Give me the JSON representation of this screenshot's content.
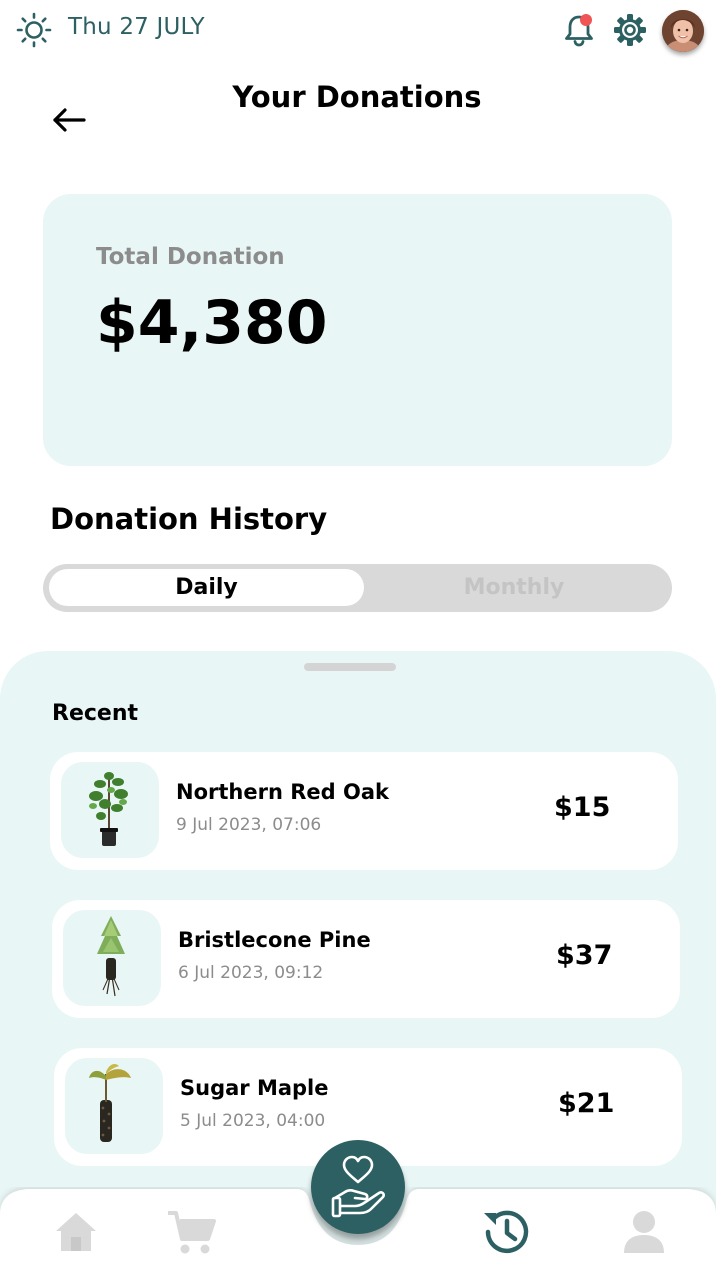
{
  "status_bar": {
    "date": "Thu 27 JULY",
    "weather_icon": "sun-icon",
    "notification_icon": "bell-icon",
    "settings_icon": "gear-icon",
    "has_unread_notification": true
  },
  "header": {
    "title": "Your Donations",
    "back_icon": "arrow-left-icon"
  },
  "summary": {
    "label": "Total Donation",
    "value": "$4,380"
  },
  "history": {
    "heading": "Donation History",
    "tabs": [
      {
        "label": "Daily",
        "selected": true
      },
      {
        "label": "Monthly",
        "selected": false
      }
    ]
  },
  "recent": {
    "heading": "Recent",
    "items": [
      {
        "name": "Northern Red Oak",
        "date": "9 Jul 2023, 07:06",
        "amount": "$15",
        "icon": "oak-sapling-icon"
      },
      {
        "name": "Bristlecone Pine",
        "date": "6 Jul 2023, 09:12",
        "amount": "$37",
        "icon": "pine-sapling-icon"
      },
      {
        "name": "Sugar Maple",
        "date": "5 Jul 2023, 04:00",
        "amount": "$21",
        "icon": "maple-sapling-icon"
      }
    ]
  },
  "nav": {
    "items": [
      "home-icon",
      "cart-icon",
      "donate-hand-heart-icon",
      "history-icon",
      "profile-icon"
    ],
    "active": "history-icon"
  },
  "colors": {
    "accent": "#2d6062",
    "card_background": "#e8f6f5",
    "notification_dot": "#f05454",
    "inactive": "#c4c4c4"
  }
}
